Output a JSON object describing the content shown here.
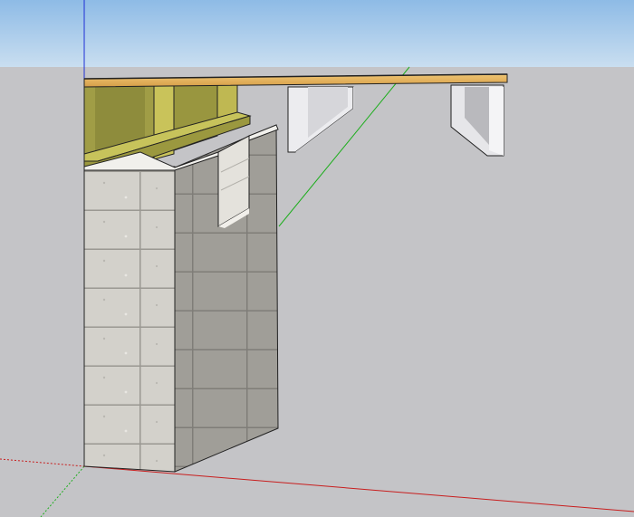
{
  "viewport": {
    "sky_color": "#9ec4ea",
    "ground_color": "#c4c4c7",
    "axes": {
      "blue": "#1f2fd6",
      "green": "#1fae1f",
      "red": "#c81e1e"
    }
  },
  "model": {
    "components": [
      "subfloor-sheathing",
      "floor-joists",
      "joist-hangers",
      "rim-joist",
      "sill-plate",
      "cmu-block-wall",
      "beam-pocket"
    ],
    "colors": {
      "plywood": "#e3b05a",
      "lumber": "#a3a044",
      "block": "#c8c6c0",
      "block_shade": "#8f8d87",
      "hanger": "#d9d9dc"
    }
  }
}
